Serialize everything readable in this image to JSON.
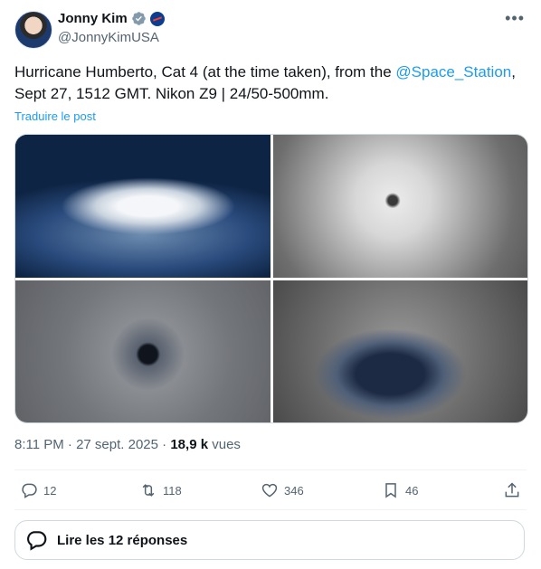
{
  "author": {
    "name": "Jonny Kim",
    "handle": "@JonnyKimUSA"
  },
  "tweet": {
    "text_before": "Hurricane Humberto, Cat 4 (at the time taken), from the ",
    "mention": "@Space_Station",
    "text_after": ", Sept 27, 1512 GMT. Nikon Z9 | 24/50-500mm.",
    "translate_label": "Traduire le post"
  },
  "meta": {
    "timestamp": "8:11 PM · 27 sept. 2025",
    "separator": " · ",
    "views_count": "18,9 k",
    "views_label": " vues"
  },
  "actions": {
    "replies": "12",
    "reposts": "118",
    "likes": "346",
    "bookmarks": "46"
  },
  "read_replies_label": "Lire les 12 réponses",
  "colors": {
    "accent": "#1d9bf0",
    "verified": "#829aab",
    "muted_text": "#536471"
  }
}
